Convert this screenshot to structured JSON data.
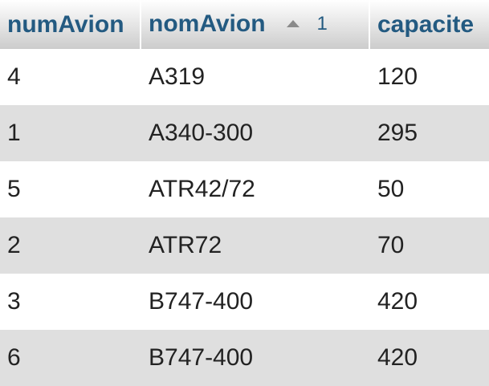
{
  "table": {
    "columns": [
      {
        "label": "numAvion",
        "sorted": false
      },
      {
        "label": "nomAvion",
        "sorted": true,
        "sort_direction": "ascending",
        "sort_order": "1"
      },
      {
        "label": "capacite",
        "sorted": false
      }
    ],
    "rows": [
      {
        "numAvion": "4",
        "nomAvion": "A319",
        "capacite": "120"
      },
      {
        "numAvion": "1",
        "nomAvion": "A340-300",
        "capacite": "295"
      },
      {
        "numAvion": "5",
        "nomAvion": "ATR42/72",
        "capacite": "50"
      },
      {
        "numAvion": "2",
        "nomAvion": "ATR72",
        "capacite": "70"
      },
      {
        "numAvion": "3",
        "nomAvion": "B747-400",
        "capacite": "420"
      },
      {
        "numAvion": "6",
        "nomAvion": "B747-400",
        "capacite": "420"
      }
    ]
  },
  "colors": {
    "header_text": "#235a81",
    "row_alt_background": "#dfdfdf",
    "sort_icon": "#8a8a8a"
  },
  "icons": {
    "sort": "sort-ascending-triangle-icon"
  }
}
